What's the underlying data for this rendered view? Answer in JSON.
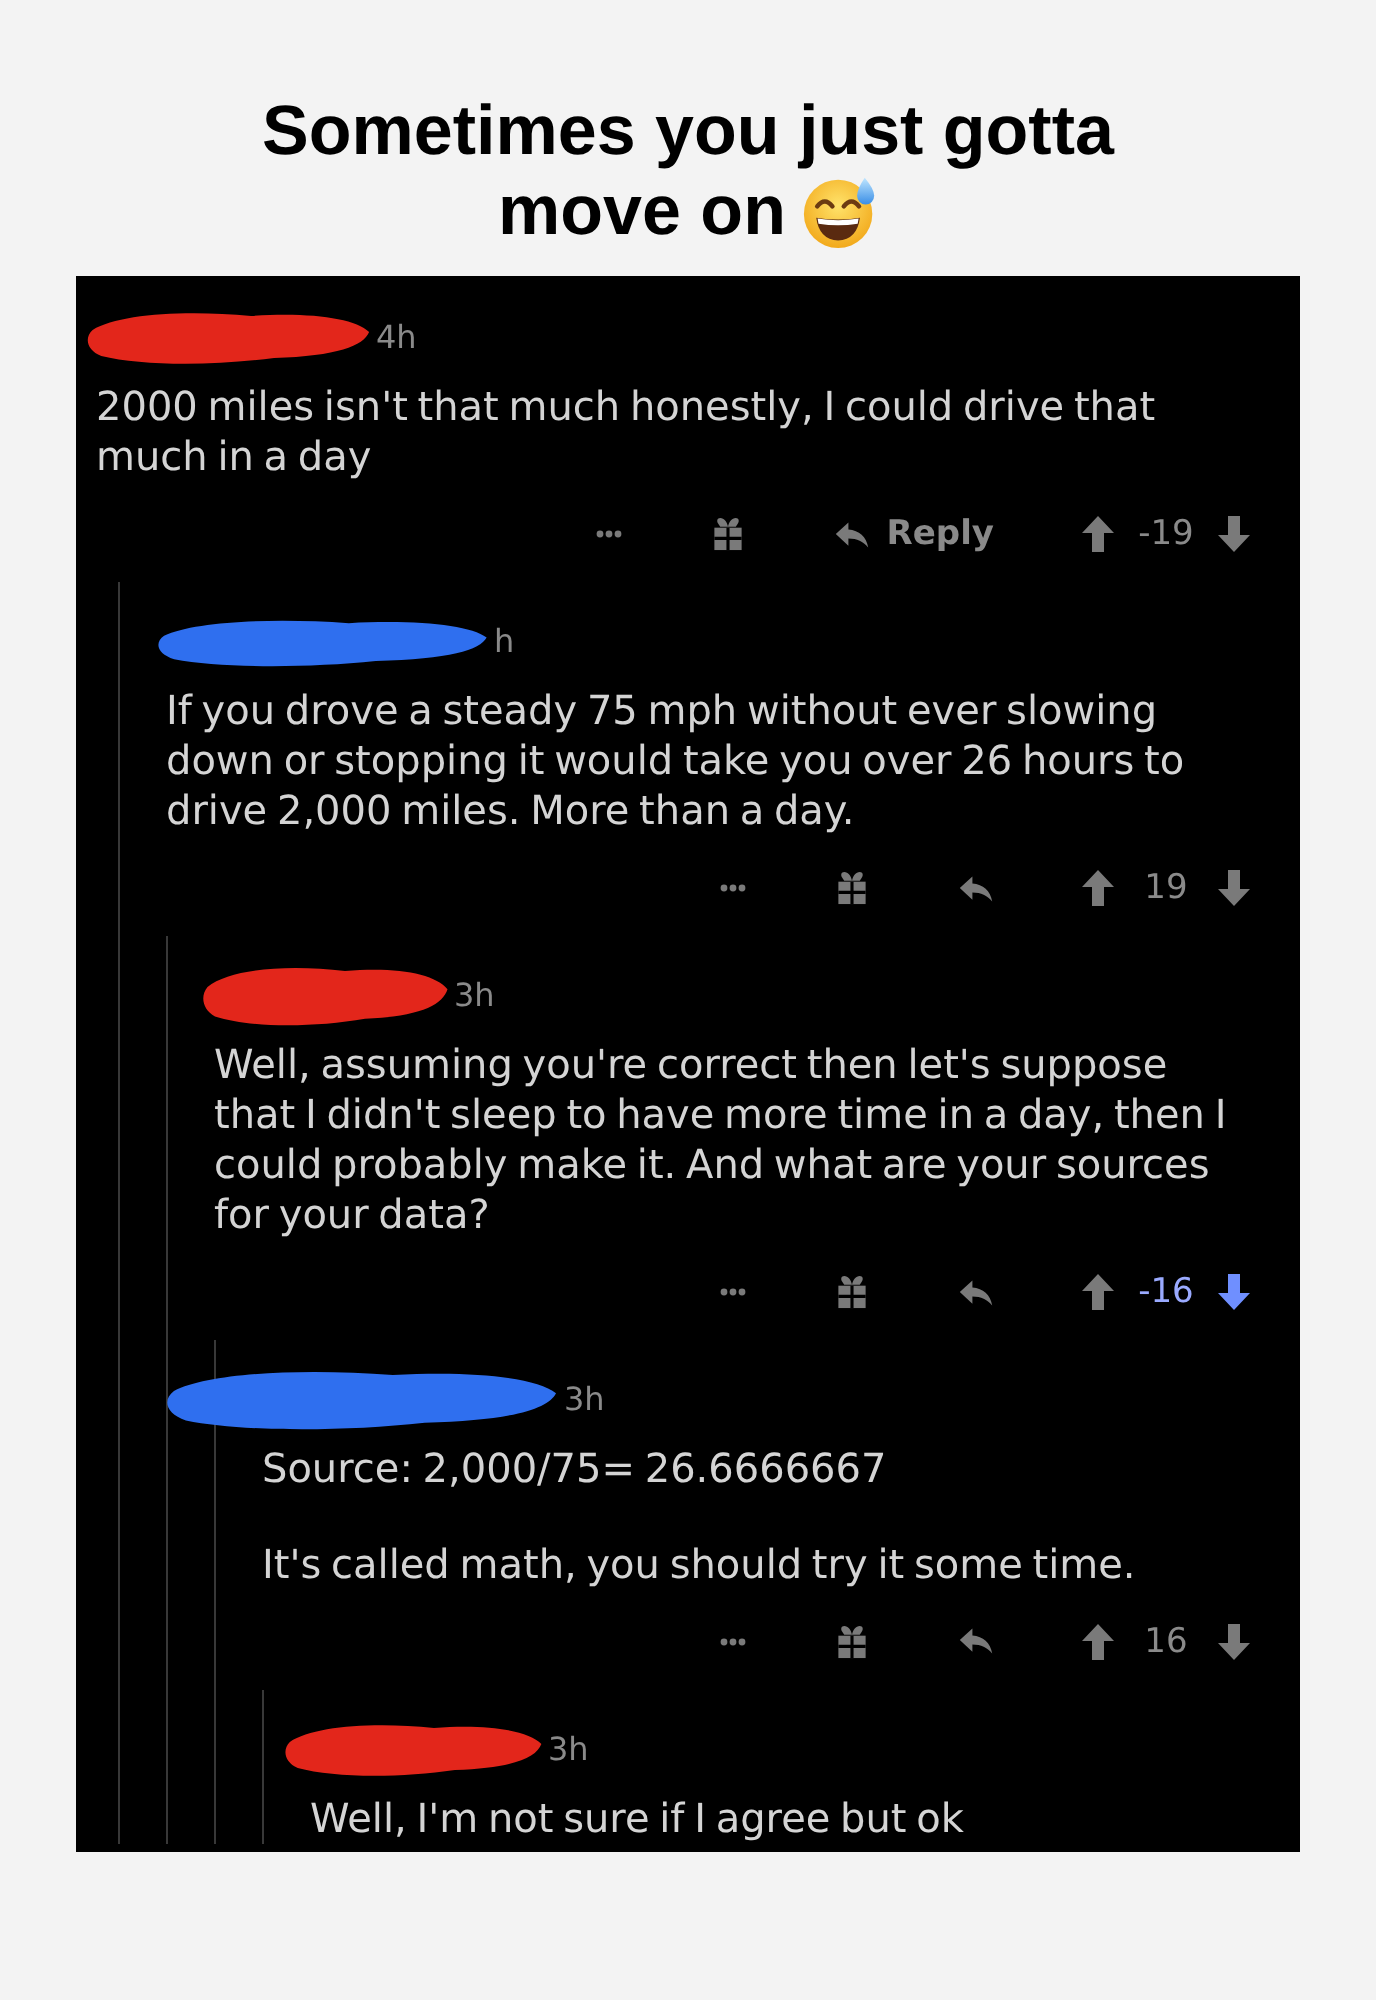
{
  "title_lines": [
    "Sometimes you just gotta",
    "move on"
  ],
  "comments": [
    {
      "redaction": {
        "color": "#e3261b"
      },
      "time": "4h",
      "body": [
        "2000 miles isn't that much honestly, I could drive that much in a day"
      ],
      "actions": {
        "reply_label": "Reply",
        "score": "-19",
        "downvoted": false
      },
      "children": [
        {
          "redaction": {
            "color": "#2f6fef"
          },
          "time": "h",
          "body": [
            "If you drove a steady 75 mph without ever slowing down or stopping it would take you over 26 hours to drive 2,000 miles. More than a day."
          ],
          "actions": {
            "score": "19",
            "downvoted": false
          },
          "children": [
            {
              "redaction": {
                "color": "#e3261b"
              },
              "time": "3h",
              "body": [
                "Well, assuming you're correct then let's suppose that I didn't sleep to have more time in a day, then I could probably make it. And what are your sources for your data?"
              ],
              "actions": {
                "score": "-16",
                "downvoted": true
              },
              "children": [
                {
                  "redaction": {
                    "color": "#2f6fef"
                  },
                  "time": "3h",
                  "body": [
                    "Source: 2,000/75= 26.6666667",
                    "It's called math, you should try it some time."
                  ],
                  "actions": {
                    "score": "16",
                    "downvoted": false
                  },
                  "children": [
                    {
                      "redaction": {
                        "color": "#e3261b"
                      },
                      "time": "3h",
                      "body": [
                        "Well, I'm not sure if I agree but ok"
                      ]
                    }
                  ]
                }
              ]
            }
          ]
        }
      ]
    }
  ]
}
